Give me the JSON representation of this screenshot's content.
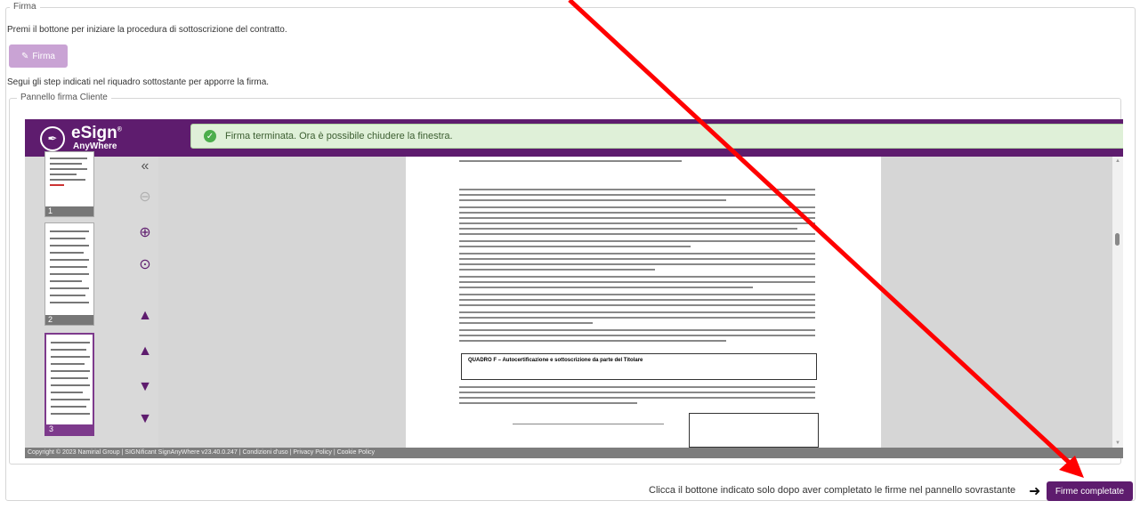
{
  "outer_fieldset": {
    "legend": "Firma"
  },
  "intro_text": "Premi il bottone per iniziare la procedura di sottoscrizione del contratto.",
  "firma_button": {
    "label": "Firma",
    "icon": "edit-icon"
  },
  "steps_text": "Segui gli step indicati nel riquadro sottostante per apporre la firma.",
  "inner_fieldset": {
    "legend": "Pannello firma Cliente"
  },
  "esign": {
    "logo_title": "eSign",
    "logo_reg": "®",
    "logo_subtitle": "AnyWhere",
    "notification": "Firma terminata. Ora è possibile chiudere la finestra.",
    "thumbnails": [
      {
        "number": "1"
      },
      {
        "number": "2"
      },
      {
        "number": "3"
      }
    ],
    "page_section_title": "QUADRO F – Autocertificazione e sottoscrizione da parte del Titolare",
    "footer": "Copyright © 2023 Namirial Group | SIGNificant SignAnyWhere v23.40.0.247 | Condizioni d'uso | Privacy Policy | Cookie Policy"
  },
  "bottom_instruction": "Clicca il bottone indicato solo dopo aver completato le firme nel pannello sovrastante",
  "complete_button": {
    "label": "Firme completate"
  },
  "colors": {
    "brand_purple": "#5e1c6e",
    "success_bg": "#dff0d8",
    "annotation_red": "#ff0000"
  }
}
